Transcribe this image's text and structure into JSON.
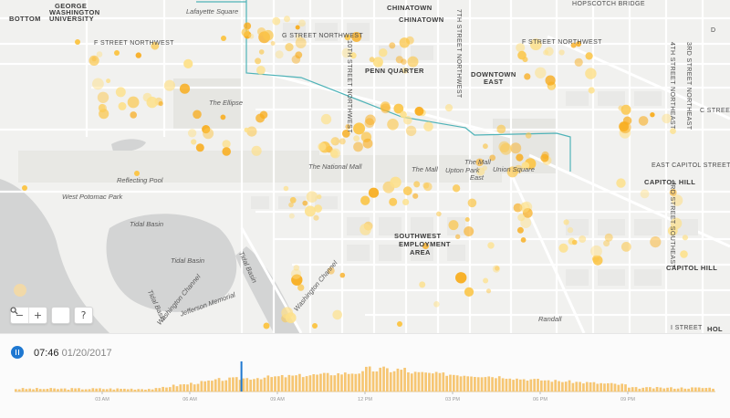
{
  "map": {
    "labels": [
      {
        "text": "BOTTOM",
        "style": "bold"
      },
      {
        "text": "GEORGE",
        "style": "bold"
      },
      {
        "text": "WASHINGTON",
        "style": "bold"
      },
      {
        "text": "UNIVERSITY",
        "style": "bold"
      },
      {
        "text": "Lafayette Square",
        "style": "italic"
      },
      {
        "text": "CHINATOWN",
        "style": "bold"
      },
      {
        "text": "CHINATOWN",
        "style": "bold"
      },
      {
        "text": "HOPSCOTCH BRIDGE",
        "style": "normal"
      },
      {
        "text": "F STREET NORTHWEST",
        "style": "normal"
      },
      {
        "text": "G STREET NORTHWEST",
        "style": "normal"
      },
      {
        "text": "F STREET NORTHWEST",
        "style": "normal"
      },
      {
        "text": "PENN QUARTER",
        "style": "bold"
      },
      {
        "text": "DOWNTOWN",
        "style": "bold"
      },
      {
        "text": "EAST",
        "style": "bold"
      },
      {
        "text": "10TH STREET NORTHWEST",
        "style": "normal"
      },
      {
        "text": "7TH STREET NORTHWEST",
        "style": "normal"
      },
      {
        "text": "4TH STREET NORTHEAST",
        "style": "normal"
      },
      {
        "text": "3RD STREET NORTHEAST",
        "style": "normal"
      },
      {
        "text": "C STREET NORTHEAST",
        "style": "normal"
      },
      {
        "text": "The Ellipse",
        "style": "italic"
      },
      {
        "text": "The National Mall",
        "style": "italic"
      },
      {
        "text": "The Mall",
        "style": "italic"
      },
      {
        "text": "The Mall",
        "style": "italic"
      },
      {
        "text": "Upton Park",
        "style": "italic"
      },
      {
        "text": "East",
        "style": "italic"
      },
      {
        "text": "Union Square",
        "style": "italic"
      },
      {
        "text": "Reflecting Pool",
        "style": "italic"
      },
      {
        "text": "West Potomac Park",
        "style": "italic"
      },
      {
        "text": "EAST CAPITOL STREET NORTHEAST",
        "style": "normal"
      },
      {
        "text": "CAPITOL HILL",
        "style": "bold"
      },
      {
        "text": "3RD STREET SOUTHEAST",
        "style": "normal"
      },
      {
        "text": "Tidal Basin",
        "style": "italic"
      },
      {
        "text": "Tidal Basin",
        "style": "italic"
      },
      {
        "text": "SOUTHWEST",
        "style": "bold"
      },
      {
        "text": "EMPLOYMENT",
        "style": "bold"
      },
      {
        "text": "AREA",
        "style": "bold"
      },
      {
        "text": "CAPITOL HILL",
        "style": "bold"
      },
      {
        "text": "Tidal Basin",
        "style": "italic"
      },
      {
        "text": "Tidal Basin",
        "style": "italic"
      },
      {
        "text": "Jefferson Memorial",
        "style": "italic"
      },
      {
        "text": "Washington Channel",
        "style": "italic"
      },
      {
        "text": "Washington Channel",
        "style": "italic"
      },
      {
        "text": "Randall",
        "style": "italic"
      },
      {
        "text": "I STREET",
        "style": "normal"
      },
      {
        "text": "HOL",
        "style": "bold"
      },
      {
        "text": "D",
        "style": "normal"
      }
    ],
    "controls": {
      "zoom_out": "−",
      "zoom_in": "+",
      "search_icon": "search-icon",
      "help": "?"
    },
    "colors": {
      "water": "#d3d4d4",
      "park": "#e8e8e4",
      "road": "#ffffff",
      "transit": "#4fb3b8",
      "dot_light": "#fde08a",
      "dot_mid": "#fbc64a",
      "dot_dark": "#f8ad1f"
    }
  },
  "playback": {
    "state_icon": "pause-icon",
    "time": "07:46",
    "date": "01/20/2017",
    "position_fraction": 0.318,
    "accent": "#1f78d1",
    "bar_color": "#f6c673"
  },
  "chart_data": {
    "type": "bar",
    "tick_labels": [
      "03 AM",
      "06 AM",
      "09 AM",
      "12 PM",
      "03 PM",
      "06 PM",
      "09 PM"
    ],
    "tick_hours": [
      3,
      6,
      9,
      12,
      15,
      18,
      21
    ],
    "x_range_hours": [
      0,
      24
    ],
    "current_hour": 7.77
  }
}
